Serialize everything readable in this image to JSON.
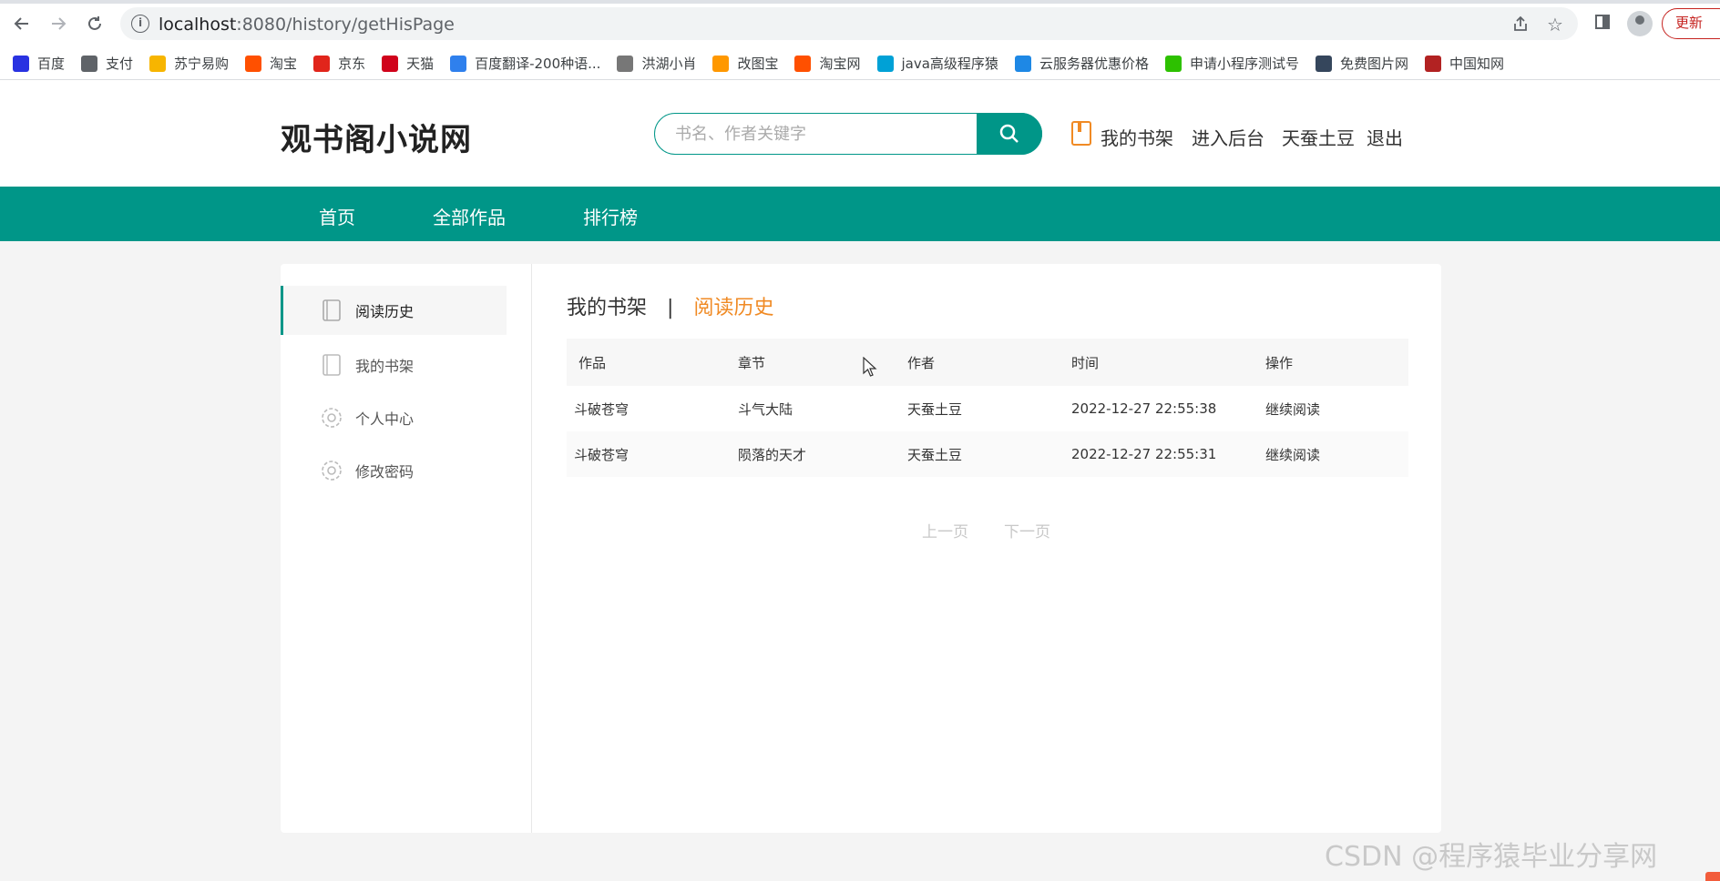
{
  "browser": {
    "url_host": "localhost",
    "url_path": ":8080/history/getHisPage",
    "update_label": "更新",
    "bookmarks": [
      {
        "label": "百度",
        "icon": "baidu-icon",
        "color": "#2932e1"
      },
      {
        "label": "支付",
        "icon": "globe-icon",
        "color": "#5f6368"
      },
      {
        "label": "苏宁易购",
        "icon": "suning-icon",
        "color": "#f7b500"
      },
      {
        "label": "淘宝",
        "icon": "taobao-icon",
        "color": "#ff5000"
      },
      {
        "label": "京东",
        "icon": "jd-icon",
        "color": "#e1251b"
      },
      {
        "label": "天猫",
        "icon": "tmall-icon",
        "color": "#d0021b"
      },
      {
        "label": "百度翻译-200种语...",
        "icon": "translate-icon",
        "color": "#2f80ed"
      },
      {
        "label": "洪湖小肖",
        "icon": "bird-icon",
        "color": "#777777"
      },
      {
        "label": "改图宝",
        "icon": "gaitubao-icon",
        "color": "#ff9800"
      },
      {
        "label": "淘宝网",
        "icon": "taobao-icon",
        "color": "#ff5000"
      },
      {
        "label": "java高级程序猿",
        "icon": "bilibili-icon",
        "color": "#00a1d6"
      },
      {
        "label": "云服务器优惠价格",
        "icon": "cloud-icon",
        "color": "#1e88e5"
      },
      {
        "label": "申请小程序测试号",
        "icon": "wechat-icon",
        "color": "#2dc100"
      },
      {
        "label": "免费图片网",
        "icon": "tumblr-icon",
        "color": "#35465c"
      },
      {
        "label": "中国知网",
        "icon": "cnki-icon",
        "color": "#b22222"
      }
    ]
  },
  "header": {
    "logo": "观书阁小说网",
    "search_placeholder": "书名、作者关键字",
    "bookshelf": "我的书架",
    "admin": "进入后台",
    "username": "天蚕土豆",
    "logout": "退出"
  },
  "nav": {
    "items": [
      "首页",
      "全部作品",
      "排行榜"
    ]
  },
  "sidebar": {
    "items": [
      "阅读历史",
      "我的书架",
      "个人中心",
      "修改密码"
    ]
  },
  "content": {
    "tab_shelf": "我的书架",
    "separator": "|",
    "tab_history": "阅读历史",
    "columns": [
      "作品",
      "章节",
      "作者",
      "时间",
      "操作"
    ],
    "rows": [
      [
        "斗破苍穹",
        "斗气大陆",
        "天蚕土豆",
        "2022-12-27 22:55:38",
        "继续阅读"
      ],
      [
        "斗破苍穹",
        "陨落的天才",
        "天蚕土豆",
        "2022-12-27 22:55:31",
        "继续阅读"
      ]
    ],
    "prev_page": "上一页",
    "next_page": "下一页"
  },
  "watermark": "CSDN @程序猿毕业分享网",
  "colors": {
    "primary": "#009688",
    "accent": "#f08a24"
  }
}
